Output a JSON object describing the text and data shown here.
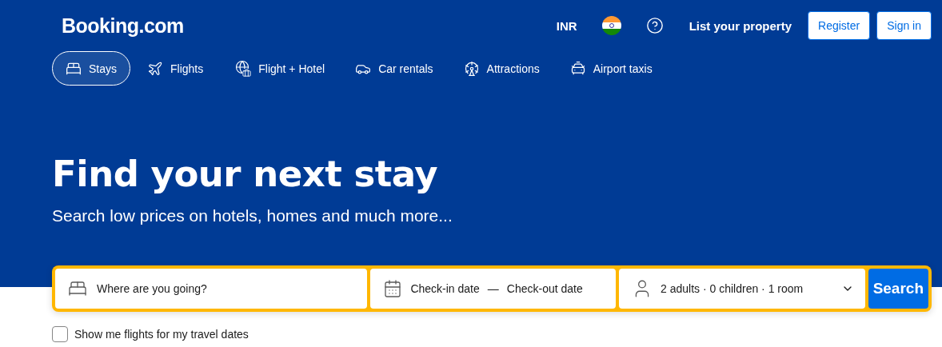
{
  "header": {
    "logo": "Booking.com",
    "currency": "INR",
    "list_property": "List your property",
    "buttons": [
      {
        "label": "Register"
      },
      {
        "label": "Sign in"
      }
    ]
  },
  "nav": [
    {
      "kind": "stays",
      "label": "Stays",
      "selected": true
    },
    {
      "kind": "flights",
      "label": "Flights",
      "selected": false
    },
    {
      "kind": "flight_hotel",
      "label": "Flight + Hotel",
      "selected": false
    },
    {
      "kind": "cars",
      "label": "Car rentals",
      "selected": false
    },
    {
      "kind": "attractions",
      "label": "Attractions",
      "selected": false
    },
    {
      "kind": "taxis",
      "label": "Airport taxis",
      "selected": false
    }
  ],
  "hero": {
    "title": "Find your next stay",
    "subtitle": "Search low prices on hotels, homes and much more..."
  },
  "search": {
    "destination": {
      "placeholder": "Where are you going?"
    },
    "dates": {
      "check_in": "Check-in date",
      "separator": "—",
      "check_out": "Check-out date"
    },
    "guests": {
      "value": "2 adults · 0 children · 1 room"
    },
    "button": "Search"
  },
  "flights_option": {
    "label": "Show me flights for my travel dates",
    "checked": false
  }
}
